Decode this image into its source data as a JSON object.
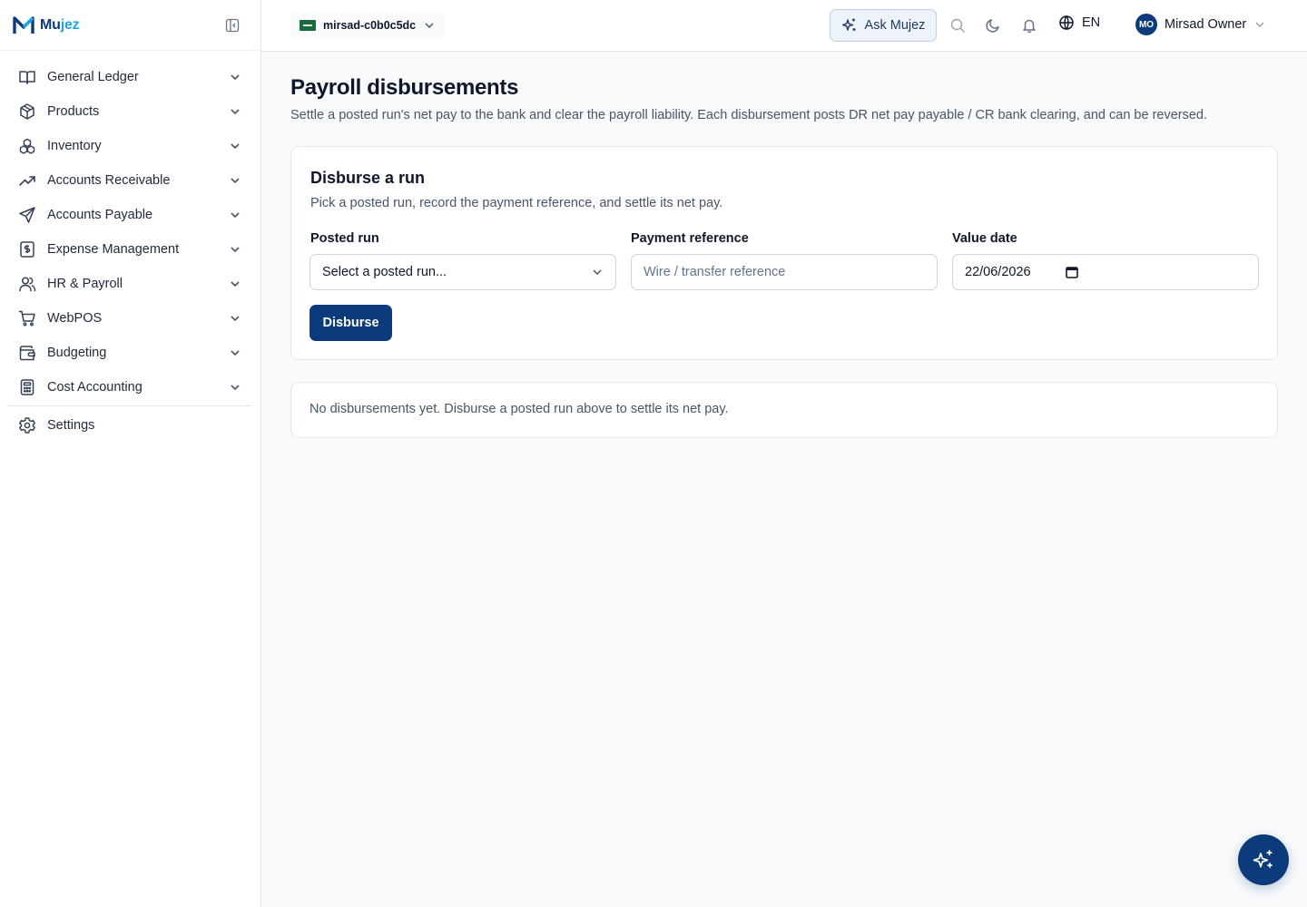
{
  "brand": {
    "name_prefix": "Mu",
    "name_suffix": "jez"
  },
  "sidebar": {
    "items": [
      {
        "label": "General Ledger",
        "icon": "book-open-icon"
      },
      {
        "label": "Products",
        "icon": "package-icon"
      },
      {
        "label": "Inventory",
        "icon": "boxes-icon"
      },
      {
        "label": "Accounts Receivable",
        "icon": "trending-up-icon"
      },
      {
        "label": "Accounts Payable",
        "icon": "send-icon"
      },
      {
        "label": "Expense Management",
        "icon": "receipt-icon"
      },
      {
        "label": "HR & Payroll",
        "icon": "users-icon"
      },
      {
        "label": "WebPOS",
        "icon": "cart-icon"
      },
      {
        "label": "Budgeting",
        "icon": "wallet-icon"
      },
      {
        "label": "Cost Accounting",
        "icon": "calculator-icon"
      }
    ],
    "settings_label": "Settings"
  },
  "topbar": {
    "org_name": "mirsad-c0b0c5dc",
    "ask_label": "Ask Mujez",
    "language": "EN",
    "user_initials": "MO",
    "user_name": "Mirsad Owner"
  },
  "page": {
    "title": "Payroll disbursements",
    "subtitle": "Settle a posted run's net pay to the bank and clear the payroll liability. Each disbursement posts DR net pay payable / CR bank clearing, and can be reversed."
  },
  "form": {
    "title": "Disburse a run",
    "subtitle": "Pick a posted run, record the payment reference, and settle its net pay.",
    "posted_run_label": "Posted run",
    "posted_run_value": "Select a posted run...",
    "reference_label": "Payment reference",
    "reference_placeholder": "Wire / transfer reference",
    "value_date_label": "Value date",
    "value_date": "22/06/2026",
    "submit_label": "Disburse"
  },
  "empty_state": "No disbursements yet. Disburse a posted run above to settle its net pay.",
  "colors": {
    "primary": "#0b3b7a",
    "accent": "#1ea7e1",
    "border": "#e2e8f0",
    "background": "#f8fafc"
  }
}
